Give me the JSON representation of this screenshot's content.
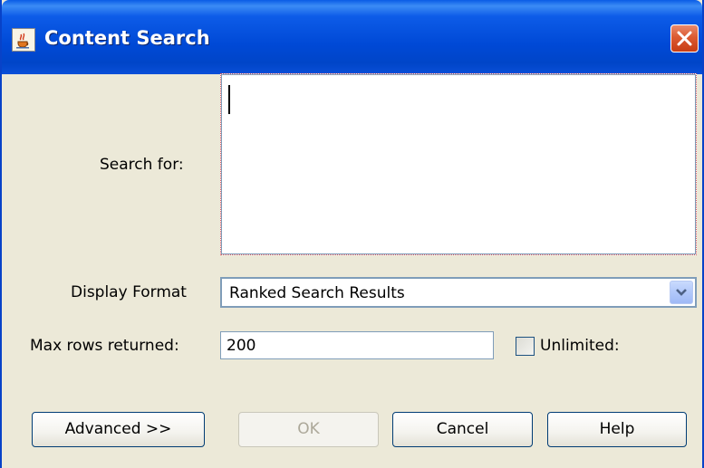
{
  "window": {
    "title": "Content Search",
    "app_icon": "java-coffee-cup-icon",
    "close_icon": "close-icon"
  },
  "form": {
    "search_for_label": "Search for:",
    "search_for_value": "",
    "display_format_label": "Display Format",
    "display_format_value": "Ranked Search Results",
    "max_rows_label": "Max rows returned:",
    "max_rows_value": "200",
    "unlimited_label": "Unlimited:",
    "unlimited_checked": false
  },
  "buttons": {
    "advanced": "Advanced >>",
    "ok": "OK",
    "cancel": "Cancel",
    "help": "Help"
  },
  "colors": {
    "titlebar": "#0049d6",
    "close": "#dc5a32",
    "panel": "#ECE9D8",
    "field_border": "#7f9db9"
  }
}
